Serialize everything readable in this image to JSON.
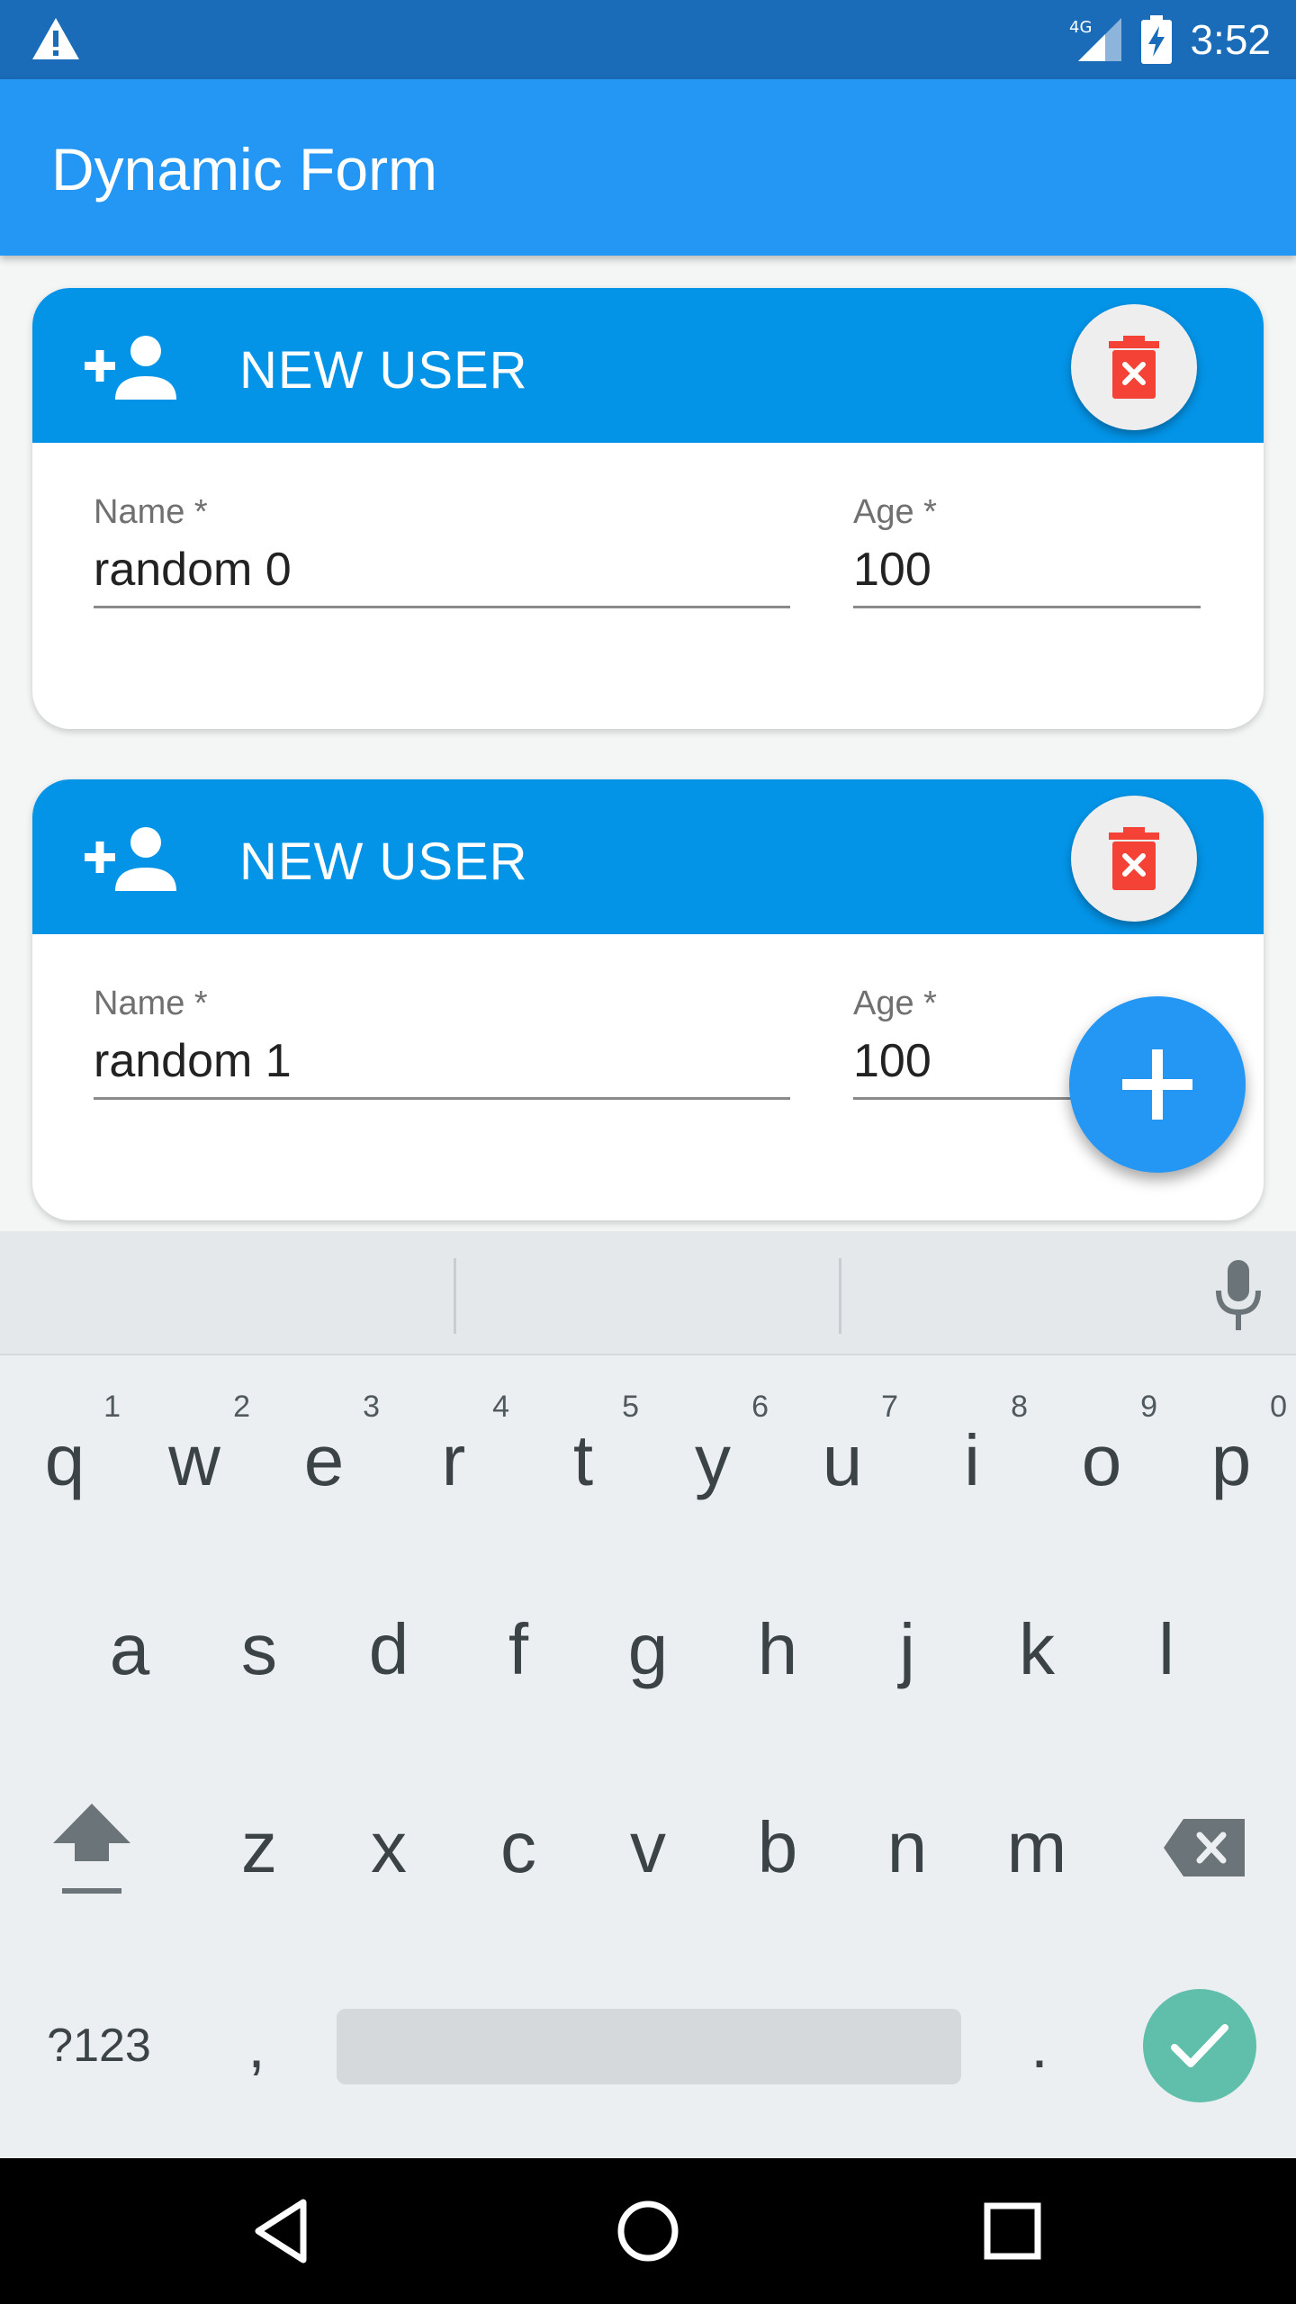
{
  "status_bar": {
    "network": "4G",
    "time": "3:52"
  },
  "app_bar": {
    "title": "Dynamic Form"
  },
  "cards": [
    {
      "title": "NEW USER",
      "name_label": "Name *",
      "name_value": "random 0",
      "age_label": "Age *",
      "age_value": "100"
    },
    {
      "title": "NEW USER",
      "name_label": "Name *",
      "name_value": "random 1",
      "age_label": "Age *",
      "age_value": "100"
    }
  ],
  "keyboard": {
    "row1": [
      {
        "key": "q",
        "hint": "1"
      },
      {
        "key": "w",
        "hint": "2"
      },
      {
        "key": "e",
        "hint": "3"
      },
      {
        "key": "r",
        "hint": "4"
      },
      {
        "key": "t",
        "hint": "5"
      },
      {
        "key": "y",
        "hint": "6"
      },
      {
        "key": "u",
        "hint": "7"
      },
      {
        "key": "i",
        "hint": "8"
      },
      {
        "key": "o",
        "hint": "9"
      },
      {
        "key": "p",
        "hint": "0"
      }
    ],
    "row2": [
      "a",
      "s",
      "d",
      "f",
      "g",
      "h",
      "j",
      "k",
      "l"
    ],
    "row3": [
      "z",
      "x",
      "c",
      "v",
      "b",
      "n",
      "m"
    ],
    "symbols_label": "?123",
    "comma_label": ",",
    "period_label": "."
  },
  "colors": {
    "status_bar": "#1a6bb8",
    "app_bar": "#2496f3",
    "card_header": "#0394e8",
    "delete_icon": "#f44336",
    "fab": "#2496f3",
    "done_key": "#5fbfaa"
  },
  "icons": {
    "status_warning": "warning-triangle-icon",
    "card_header": "person-add-icon",
    "delete": "trash-icon",
    "fab": "plus-icon",
    "mic": "microphone-icon",
    "shift": "shift-arrow-icon",
    "backspace": "backspace-icon",
    "done": "checkmark-icon",
    "nav_back": "triangle-back-icon",
    "nav_home": "circle-home-icon",
    "nav_recents": "square-recents-icon"
  }
}
